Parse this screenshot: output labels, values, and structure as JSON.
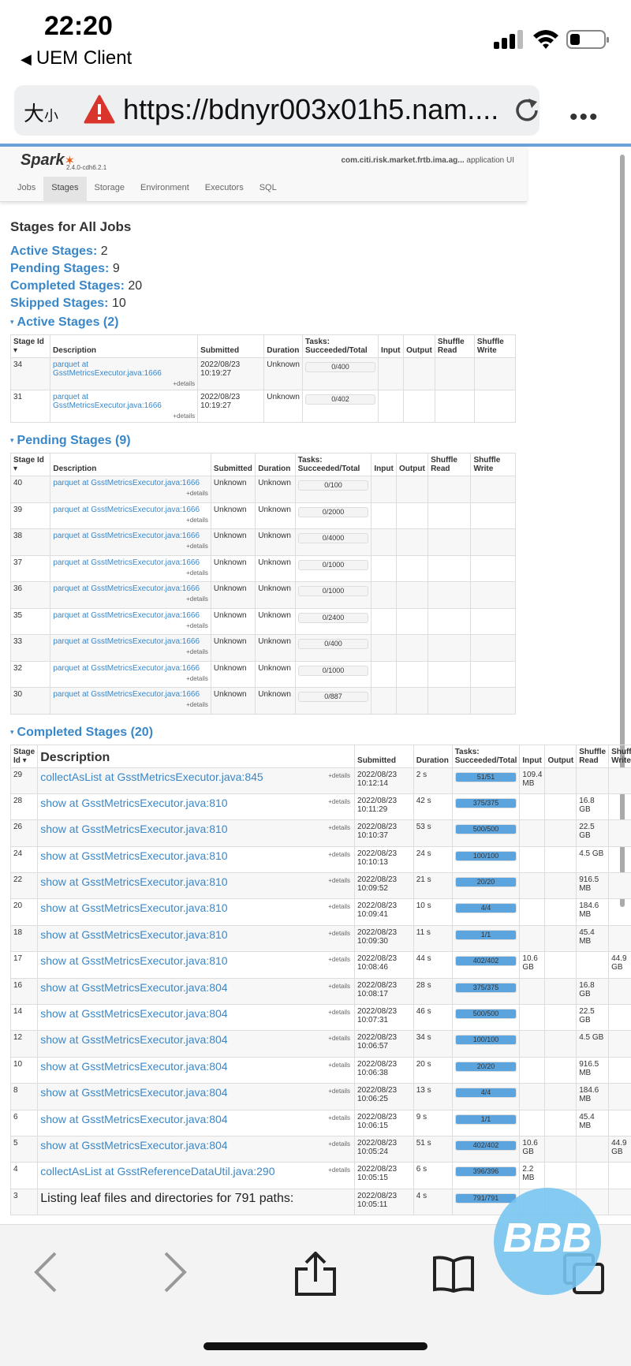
{
  "status_bar": {
    "time": "22:20",
    "back_app": "UEM Client"
  },
  "browser": {
    "text_size": "大",
    "text_size_small": "小",
    "url": "https://bdnyr003x01h5.nam....",
    "more_icon": "ellipsis-icon"
  },
  "spark": {
    "logo": "Spark",
    "version": "2.4.0-cdh6.2.1",
    "app_name": "com.citi.risk.market.frtb.ima.ag...",
    "app_suffix": " application UI",
    "tabs": [
      "Jobs",
      "Stages",
      "Storage",
      "Environment",
      "Executors",
      "SQL"
    ]
  },
  "page": {
    "title": "Stages for All Jobs",
    "summary": [
      {
        "label": "Active Stages:",
        "value": "2"
      },
      {
        "label": "Pending Stages:",
        "value": "9"
      },
      {
        "label": "Completed Stages:",
        "value": "20"
      },
      {
        "label": "Skipped Stages:",
        "value": "10"
      }
    ]
  },
  "active": {
    "heading": "Active Stages (2)",
    "headers": {
      "id": "Stage Id",
      "sort": "▾",
      "desc": "Description",
      "submitted": "Submitted",
      "duration": "Duration",
      "tasks": "Tasks: Succeeded/Total",
      "input": "Input",
      "output": "Output",
      "sread": "Shuffle Read",
      "swrite": "Shuffle Write"
    },
    "details": "+details",
    "rows": [
      {
        "id": "34",
        "desc": "parquet at GsstMetricsExecutor.java:1666",
        "submitted": "2022/08/23 10:19:27",
        "duration": "Unknown",
        "tasks": "0/400",
        "frac": 0
      },
      {
        "id": "31",
        "desc": "parquet at GsstMetricsExecutor.java:1666",
        "submitted": "2022/08/23 10:19:27",
        "duration": "Unknown",
        "tasks": "0/402",
        "frac": 0
      }
    ]
  },
  "pending": {
    "heading": "Pending Stages (9)",
    "rows": [
      {
        "id": "40",
        "desc": "parquet at GsstMetricsExecutor.java:1666",
        "submitted": "Unknown",
        "duration": "Unknown",
        "tasks": "0/100",
        "frac": 0
      },
      {
        "id": "39",
        "desc": "parquet at GsstMetricsExecutor.java:1666",
        "submitted": "Unknown",
        "duration": "Unknown",
        "tasks": "0/2000",
        "frac": 0
      },
      {
        "id": "38",
        "desc": "parquet at GsstMetricsExecutor.java:1666",
        "submitted": "Unknown",
        "duration": "Unknown",
        "tasks": "0/4000",
        "frac": 0
      },
      {
        "id": "37",
        "desc": "parquet at GsstMetricsExecutor.java:1666",
        "submitted": "Unknown",
        "duration": "Unknown",
        "tasks": "0/1000",
        "frac": 0
      },
      {
        "id": "36",
        "desc": "parquet at GsstMetricsExecutor.java:1666",
        "submitted": "Unknown",
        "duration": "Unknown",
        "tasks": "0/1000",
        "frac": 0
      },
      {
        "id": "35",
        "desc": "parquet at GsstMetricsExecutor.java:1666",
        "submitted": "Unknown",
        "duration": "Unknown",
        "tasks": "0/2400",
        "frac": 0
      },
      {
        "id": "33",
        "desc": "parquet at GsstMetricsExecutor.java:1666",
        "submitted": "Unknown",
        "duration": "Unknown",
        "tasks": "0/400",
        "frac": 0
      },
      {
        "id": "32",
        "desc": "parquet at GsstMetricsExecutor.java:1666",
        "submitted": "Unknown",
        "duration": "Unknown",
        "tasks": "0/1000",
        "frac": 0
      },
      {
        "id": "30",
        "desc": "parquet at GsstMetricsExecutor.java:1666",
        "submitted": "Unknown",
        "duration": "Unknown",
        "tasks": "0/887",
        "frac": 0
      }
    ]
  },
  "completed": {
    "heading": "Completed Stages (20)",
    "headers": {
      "id": "Stage Id",
      "sort": "▾",
      "desc": "Description",
      "submitted": "Submitted",
      "duration": "Duration",
      "tasks": "Tasks: Succeeded/Total",
      "input": "Input",
      "output": "Output",
      "sread": "Shuffle Read",
      "swrite": "Shuffle Write"
    },
    "rows": [
      {
        "id": "29",
        "desc": "collectAsList at GsstMetricsExecutor.java:845",
        "submitted": "2022/08/23 10:12:14",
        "duration": "2 s",
        "tasks": "51/51",
        "frac": 1,
        "input": "109.4 MB",
        "output": "",
        "sread": "",
        "swrite": ""
      },
      {
        "id": "28",
        "desc": "show at GsstMetricsExecutor.java:810",
        "submitted": "2022/08/23 10:11:29",
        "duration": "42 s",
        "tasks": "375/375",
        "frac": 1,
        "input": "",
        "output": "",
        "sread": "16.8 GB",
        "swrite": ""
      },
      {
        "id": "26",
        "desc": "show at GsstMetricsExecutor.java:810",
        "submitted": "2022/08/23 10:10:37",
        "duration": "53 s",
        "tasks": "500/500",
        "frac": 1,
        "input": "",
        "output": "",
        "sread": "22.5 GB",
        "swrite": ""
      },
      {
        "id": "24",
        "desc": "show at GsstMetricsExecutor.java:810",
        "submitted": "2022/08/23 10:10:13",
        "duration": "24 s",
        "tasks": "100/100",
        "frac": 1,
        "input": "",
        "output": "",
        "sread": "4.5 GB",
        "swrite": ""
      },
      {
        "id": "22",
        "desc": "show at GsstMetricsExecutor.java:810",
        "submitted": "2022/08/23 10:09:52",
        "duration": "21 s",
        "tasks": "20/20",
        "frac": 1,
        "input": "",
        "output": "",
        "sread": "916.5 MB",
        "swrite": ""
      },
      {
        "id": "20",
        "desc": "show at GsstMetricsExecutor.java:810",
        "submitted": "2022/08/23 10:09:41",
        "duration": "10 s",
        "tasks": "4/4",
        "frac": 1,
        "input": "",
        "output": "",
        "sread": "184.6 MB",
        "swrite": ""
      },
      {
        "id": "18",
        "desc": "show at GsstMetricsExecutor.java:810",
        "submitted": "2022/08/23 10:09:30",
        "duration": "11 s",
        "tasks": "1/1",
        "frac": 1,
        "input": "",
        "output": "",
        "sread": "45.4 MB",
        "swrite": ""
      },
      {
        "id": "17",
        "desc": "show at GsstMetricsExecutor.java:810",
        "submitted": "2022/08/23 10:08:46",
        "duration": "44 s",
        "tasks": "402/402",
        "frac": 1,
        "input": "10.6 GB",
        "output": "",
        "sread": "",
        "swrite": "44.9 GB"
      },
      {
        "id": "16",
        "desc": "show at GsstMetricsExecutor.java:804",
        "submitted": "2022/08/23 10:08:17",
        "duration": "28 s",
        "tasks": "375/375",
        "frac": 1,
        "input": "",
        "output": "",
        "sread": "16.8 GB",
        "swrite": ""
      },
      {
        "id": "14",
        "desc": "show at GsstMetricsExecutor.java:804",
        "submitted": "2022/08/23 10:07:31",
        "duration": "46 s",
        "tasks": "500/500",
        "frac": 1,
        "input": "",
        "output": "",
        "sread": "22.5 GB",
        "swrite": ""
      },
      {
        "id": "12",
        "desc": "show at GsstMetricsExecutor.java:804",
        "submitted": "2022/08/23 10:06:57",
        "duration": "34 s",
        "tasks": "100/100",
        "frac": 1,
        "input": "",
        "output": "",
        "sread": "4.5 GB",
        "swrite": ""
      },
      {
        "id": "10",
        "desc": "show at GsstMetricsExecutor.java:804",
        "submitted": "2022/08/23 10:06:38",
        "duration": "20 s",
        "tasks": "20/20",
        "frac": 1,
        "input": "",
        "output": "",
        "sread": "916.5 MB",
        "swrite": ""
      },
      {
        "id": "8",
        "desc": "show at GsstMetricsExecutor.java:804",
        "submitted": "2022/08/23 10:06:25",
        "duration": "13 s",
        "tasks": "4/4",
        "frac": 1,
        "input": "",
        "output": "",
        "sread": "184.6 MB",
        "swrite": ""
      },
      {
        "id": "6",
        "desc": "show at GsstMetricsExecutor.java:804",
        "submitted": "2022/08/23 10:06:15",
        "duration": "9 s",
        "tasks": "1/1",
        "frac": 1,
        "input": "",
        "output": "",
        "sread": "45.4 MB",
        "swrite": ""
      },
      {
        "id": "5",
        "desc": "show at GsstMetricsExecutor.java:804",
        "submitted": "2022/08/23 10:05:24",
        "duration": "51 s",
        "tasks": "402/402",
        "frac": 1,
        "input": "10.6 GB",
        "output": "",
        "sread": "",
        "swrite": "44.9 GB"
      },
      {
        "id": "4",
        "desc": "collectAsList at GsstReferenceDataUtil.java:290",
        "submitted": "2022/08/23 10:05:15",
        "duration": "6 s",
        "tasks": "396/396",
        "frac": 1,
        "input": "2.2 MB",
        "output": "",
        "sread": "",
        "swrite": ""
      },
      {
        "id": "3",
        "desc": "Listing leaf files and directories for 791 paths:",
        "plain": true,
        "submitted": "2022/08/23 10:05:11",
        "duration": "4 s",
        "tasks": "791/791",
        "frac": 1,
        "input": "",
        "output": "",
        "sread": "",
        "swrite": ""
      }
    ]
  },
  "colors": {
    "link": "#3a87c8",
    "progress": "#5ba4de",
    "blackberry": "#78c4f0"
  },
  "overlay": {
    "blackberry_badge": "BBB"
  }
}
